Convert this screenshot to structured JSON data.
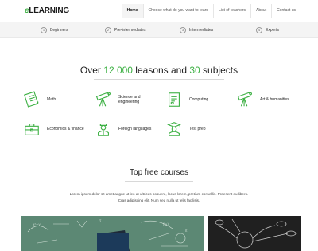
{
  "brand": {
    "prefix": "e",
    "name": "LEARNING"
  },
  "nav": [
    {
      "label": "Home",
      "active": true
    },
    {
      "label": "Choose what do you want to learn"
    },
    {
      "label": "List of teachers"
    },
    {
      "label": "About"
    },
    {
      "label": "Contact us"
    }
  ],
  "levels": [
    {
      "num": "1",
      "label": "Beginners"
    },
    {
      "num": "2",
      "label": "Pre-intermediates"
    },
    {
      "num": "3",
      "label": "Intermediates"
    },
    {
      "num": "4",
      "label": "Experts"
    }
  ],
  "headline": {
    "p1": "Over ",
    "n1": "12 000",
    "p2": " leasons and ",
    "n2": "30",
    "p3": " subjects"
  },
  "subjects": [
    {
      "label": "Math",
      "icon": "math-notebook-icon"
    },
    {
      "label": "Science and engineering",
      "icon": "telescope-icon"
    },
    {
      "label": "Computing",
      "icon": "computing-document-icon"
    },
    {
      "label": "Art & humanities",
      "icon": "telescope-icon"
    },
    {
      "label": "Economics & finance",
      "icon": "briefcase-icon"
    },
    {
      "label": "Foreign languages",
      "icon": "student-icon"
    },
    {
      "label": "Test prep",
      "icon": "graduate-icon"
    }
  ],
  "courses": {
    "title": "Top free courses",
    "description": "Lorem ipsum dolor sit amet augue ut leo at ultrices posuere, locus lorem, pretium convallis. Praesent ou libero. Cras adipiscing elit. Num sed nulla ut felis facilisis."
  },
  "colors": {
    "accent": "#3cb043"
  }
}
